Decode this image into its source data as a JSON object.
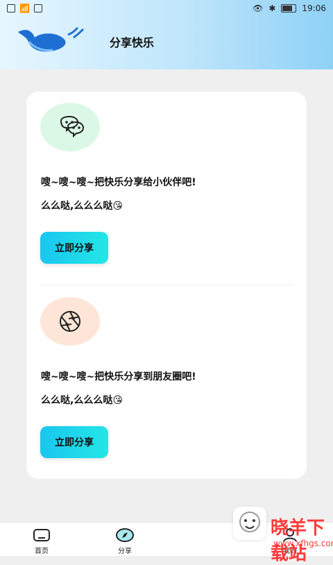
{
  "status_bar": {
    "time": "19:06"
  },
  "header": {
    "title": "分享快乐"
  },
  "cards": [
    {
      "text": "嗖~嗖~嗖~把快乐分享给小伙伴吧!",
      "subtext": "么么哒,么么么哒",
      "emoji": "😘",
      "button_label": "立即分享",
      "icon_color": "#dbf8e6"
    },
    {
      "text": "嗖~嗖~嗖~把快乐分享到朋友圈吧!",
      "subtext": "么么哒,么么么哒",
      "emoji": "😘",
      "button_label": "立即分享",
      "icon_color": "#fde6d7"
    }
  ],
  "tabs": [
    {
      "label": "首页"
    },
    {
      "label": "分享"
    },
    {
      "label": "我的"
    }
  ],
  "watermark": {
    "text": "晓羊下载站",
    "url": "www.xfhgs.com"
  }
}
